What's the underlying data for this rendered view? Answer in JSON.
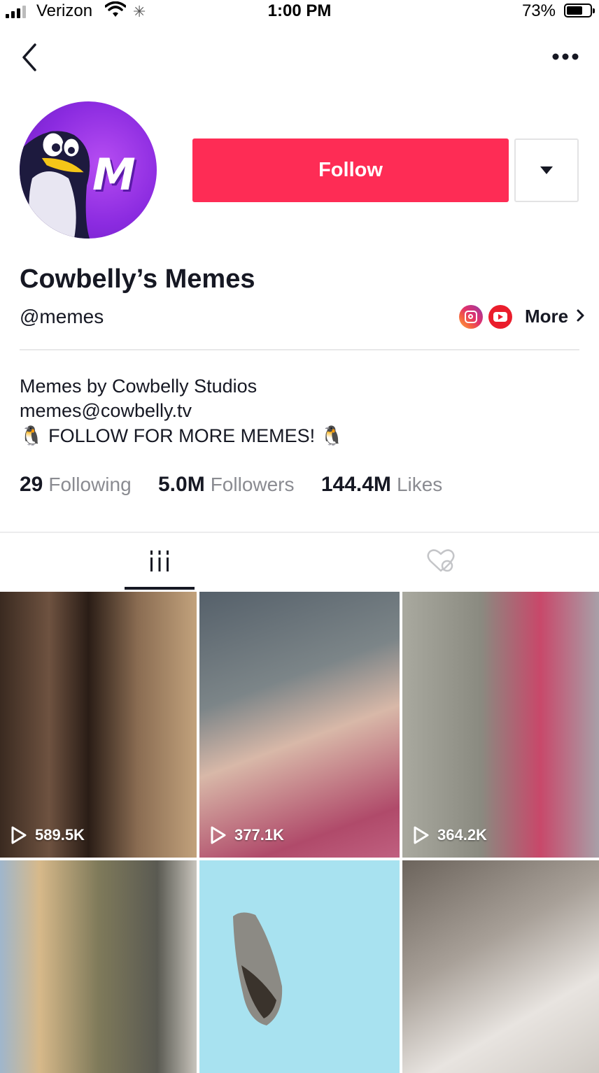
{
  "status_bar": {
    "carrier": "Verizon",
    "time": "1:00 PM",
    "battery": "73%"
  },
  "profile": {
    "avatar_letter": "M",
    "follow_label": "Follow",
    "display_name": "Cowbelly’s Memes",
    "handle": "@memes",
    "more_label": "More",
    "bio": [
      "Memes by Cowbelly Studios",
      "memes@cowbelly.tv",
      "🐧 FOLLOW FOR MORE MEMES! 🐧"
    ],
    "stats": [
      {
        "value": "29",
        "label": "Following"
      },
      {
        "value": "5.0M",
        "label": "Followers"
      },
      {
        "value": "144.4M",
        "label": "Likes"
      }
    ]
  },
  "colors": {
    "follow": "#fe2c55",
    "text": "#161823",
    "muted": "#8a8b91"
  },
  "tabs": [
    {
      "icon": "videos-grid-icon",
      "selected": true
    },
    {
      "icon": "liked-hidden-icon",
      "selected": false
    }
  ],
  "videos": [
    {
      "views": "589.5K"
    },
    {
      "views": "377.1K"
    },
    {
      "views": "364.2K"
    },
    {
      "views": ""
    },
    {
      "views": ""
    },
    {
      "views": ""
    }
  ]
}
